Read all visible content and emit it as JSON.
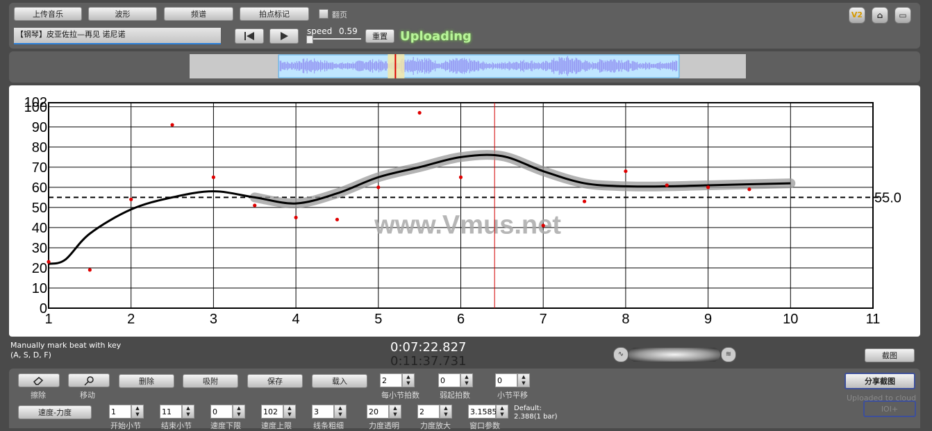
{
  "top": {
    "upload_music": "上传音乐",
    "waveform": "波形",
    "spectrum": "频谱",
    "beat_mark": "拍点标记",
    "page_turn": "翻页",
    "track_title": "【钢琴】皮亚佐拉—再见 诺尼诺",
    "speed_label": "speed",
    "speed_value": "0.59",
    "reset": "重置",
    "status": "Uploading",
    "v2_icon": "V2"
  },
  "overview": {
    "selection_start": 0.16,
    "selection_end": 0.88,
    "playhead": 0.37
  },
  "chart_data": {
    "type": "line",
    "x_ticks": [
      "1",
      "2",
      "3",
      "4",
      "5",
      "6",
      "7",
      "8",
      "9",
      "10",
      "11"
    ],
    "y_ticks": [
      "0",
      "10",
      "20",
      "30",
      "40",
      "50",
      "60",
      "70",
      "80",
      "90",
      "100"
    ],
    "y_top_label": "102",
    "xlim": [
      1,
      11
    ],
    "ylim": [
      0,
      102
    ],
    "reference_line": {
      "value": 55.0,
      "label": "55.0"
    },
    "cursor_x": 6.41,
    "watermark": "www.Vmus.net",
    "curve": [
      [
        1,
        22
      ],
      [
        1.2,
        24
      ],
      [
        1.5,
        37
      ],
      [
        2,
        49
      ],
      [
        2.5,
        55
      ],
      [
        3,
        58
      ],
      [
        3.5,
        55
      ],
      [
        4,
        52
      ],
      [
        4.5,
        57
      ],
      [
        5,
        65
      ],
      [
        5.5,
        70
      ],
      [
        6,
        75
      ],
      [
        6.5,
        75.5
      ],
      [
        7,
        68
      ],
      [
        7.5,
        62
      ],
      [
        8,
        60.5
      ],
      [
        8.5,
        60.5
      ],
      [
        9,
        61
      ],
      [
        9.5,
        61.5
      ],
      [
        10,
        62
      ]
    ],
    "points": [
      [
        1,
        23
      ],
      [
        1.5,
        19
      ],
      [
        2,
        54
      ],
      [
        2.5,
        91
      ],
      [
        3,
        65
      ],
      [
        3.5,
        51
      ],
      [
        4,
        45
      ],
      [
        4.5,
        44
      ],
      [
        5,
        60
      ],
      [
        5.5,
        97
      ],
      [
        6,
        65
      ],
      [
        7,
        41
      ],
      [
        7.5,
        53
      ],
      [
        8,
        68
      ],
      [
        8.5,
        61
      ],
      [
        9,
        60
      ],
      [
        9.5,
        59
      ]
    ]
  },
  "info": {
    "hint_line1": "Manually mark beat with key",
    "hint_line2": "(A, S, D, F)",
    "time_current": "0:07:22.827",
    "time_total": "0:11:37.731",
    "screenshot": "截图"
  },
  "bottom": {
    "erase": "擦除",
    "move": "移动",
    "delete": "删除",
    "snap": "吸附",
    "save": "保存",
    "load": "载入",
    "beats_per_bar_value": "2",
    "beats_per_bar_label": "每小节拍数",
    "upbeat_value": "0",
    "upbeat_label": "弱起拍数",
    "bar_shift_value": "0",
    "bar_shift_label": "小节平移",
    "share": "分享截图",
    "uploaded": "Uploaded to cloud",
    "tempo_dynamics": "速度-力度",
    "start_bar_value": "1",
    "start_bar_label": "开始小节",
    "end_bar_value": "11",
    "end_bar_label": "结束小节",
    "tempo_min_value": "0",
    "tempo_min_label": "速度下限",
    "tempo_max_value": "102",
    "tempo_max_label": "速度上限",
    "line_width_value": "3",
    "line_width_label": "线条粗细",
    "opacity_value": "20",
    "opacity_label": "力度透明",
    "dyn_scale_value": "2",
    "dyn_scale_label": "力度放大",
    "window_value": "3.1585",
    "window_label": "窗口参数",
    "default_line1": "Default:",
    "default_line2": "2.388(1 bar)",
    "ioi": "IOI+"
  }
}
